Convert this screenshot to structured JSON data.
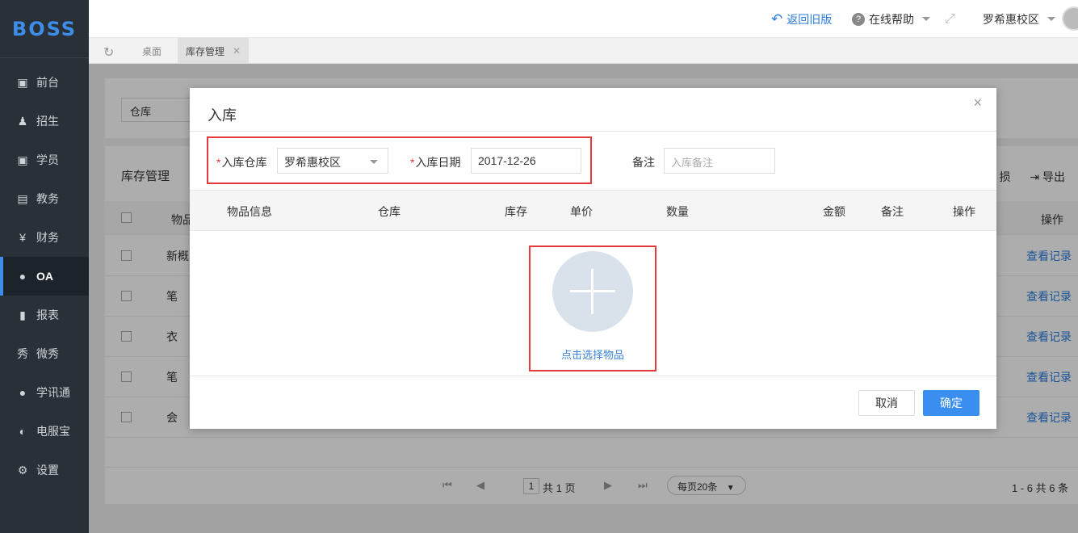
{
  "app": {
    "logo": "BOSS"
  },
  "sidebar": {
    "items": [
      {
        "label": "前台",
        "icon": "calendar-icon",
        "glyph": "▣"
      },
      {
        "label": "招生",
        "icon": "user-add-icon",
        "glyph": "♟"
      },
      {
        "label": "学员",
        "icon": "student-icon",
        "glyph": "▣"
      },
      {
        "label": "教务",
        "icon": "book-icon",
        "glyph": "▤"
      },
      {
        "label": "财务",
        "icon": "yen-icon",
        "glyph": "¥"
      },
      {
        "label": "OA",
        "icon": "chat-icon",
        "glyph": "●",
        "active": true
      },
      {
        "label": "报表",
        "icon": "bar-chart-icon",
        "glyph": "▮"
      },
      {
        "label": "微秀",
        "icon": "xiu-icon",
        "glyph": "秀"
      },
      {
        "label": "学讯通",
        "icon": "location-icon",
        "glyph": "●"
      },
      {
        "label": "电服宝",
        "icon": "phone-icon",
        "glyph": "◐"
      },
      {
        "label": "设置",
        "icon": "gear-icon",
        "glyph": "⚙"
      }
    ]
  },
  "header": {
    "back_old": "返回旧版",
    "help": "在线帮助",
    "campus": "罗希惠校区"
  },
  "tabs": [
    {
      "label": "桌面"
    },
    {
      "label": "库存管理",
      "closable": true
    }
  ],
  "background_page": {
    "filter_warehouse": "仓库",
    "list_title": "库存管理",
    "tools_partial": "损",
    "export": "导出",
    "col_goods_partial": "物品",
    "col_ops": "操作",
    "rows": [
      {
        "text": "新概",
        "link": "查看记录"
      },
      {
        "text": "笔",
        "link": "查看记录"
      },
      {
        "text": "衣",
        "link": "查看记录"
      },
      {
        "text": "笔",
        "link": "查看记录"
      },
      {
        "text": "会",
        "link": "查看记录"
      }
    ],
    "pager": {
      "page": "1",
      "total_pages": "共 1 页",
      "per_page": "每页20条",
      "summary": "1 - 6  共 6 条"
    }
  },
  "modal": {
    "title": "入库",
    "warehouse_label": "入库仓库",
    "warehouse_value": "罗希惠校区",
    "date_label": "入库日期",
    "date_value": "2017-12-26",
    "remark_label": "备注",
    "remark_placeholder": "入库备注",
    "columns": [
      "物品信息",
      "仓库",
      "库存",
      "单价",
      "数量",
      "金额",
      "备注",
      "操作"
    ],
    "add_label": "点击选择物品",
    "cancel": "取消",
    "confirm": "确定"
  },
  "colors": {
    "accent": "#3a8ef0",
    "highlight": "#e53a3a",
    "sidebar_bg": "#293038"
  }
}
